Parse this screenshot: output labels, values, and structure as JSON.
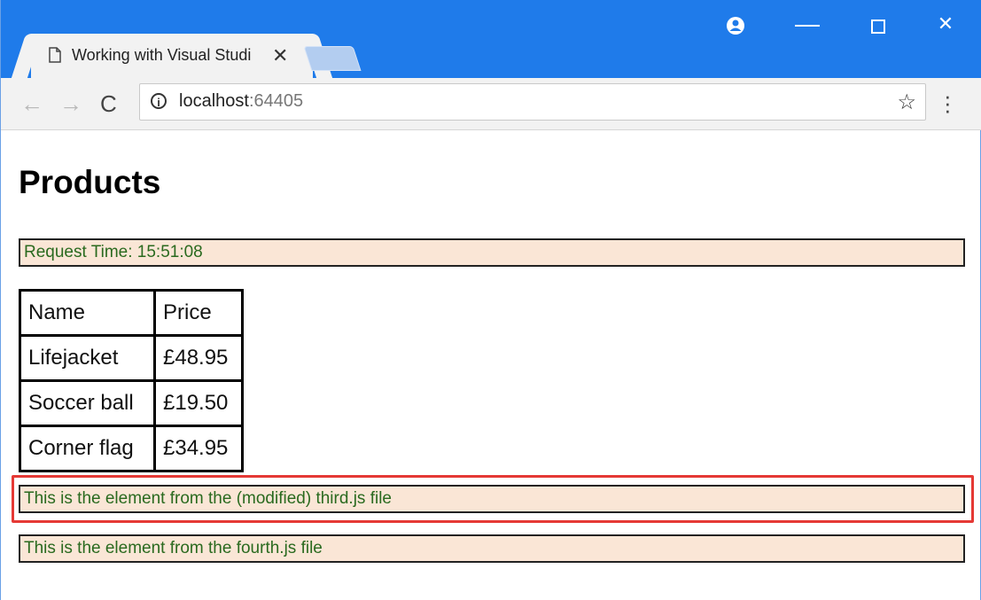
{
  "browser": {
    "tab_title": "Working with Visual Studi",
    "tab_close": "✕",
    "url_host": "localhost",
    "url_port": ":64405",
    "icons": {
      "back": "arrow-left-icon",
      "forward": "arrow-right-icon",
      "reload": "reload-icon",
      "info": "info-icon",
      "bookmark": "star-icon",
      "menu": "more-vert-icon",
      "profile": "account-icon"
    },
    "window_controls": {
      "minimize": "—",
      "maximize": "☐",
      "close": "✕"
    }
  },
  "page": {
    "heading": "Products",
    "request_time": "Request Time: 15:51:08",
    "table": {
      "headers": [
        "Name",
        "Price"
      ],
      "rows": [
        [
          "Lifejacket",
          "£48.95"
        ],
        [
          "Soccer ball",
          "£19.50"
        ],
        [
          "Corner flag",
          "£34.95"
        ]
      ]
    },
    "element_third": "This is the element from the (modified) third.js file",
    "element_fourth": "This is the element from the fourth.js file"
  },
  "colors": {
    "titlebar": "#1f7bea",
    "message_bg": "#fae6d6",
    "message_text": "#2a6a1f",
    "highlight": "#e53935"
  }
}
